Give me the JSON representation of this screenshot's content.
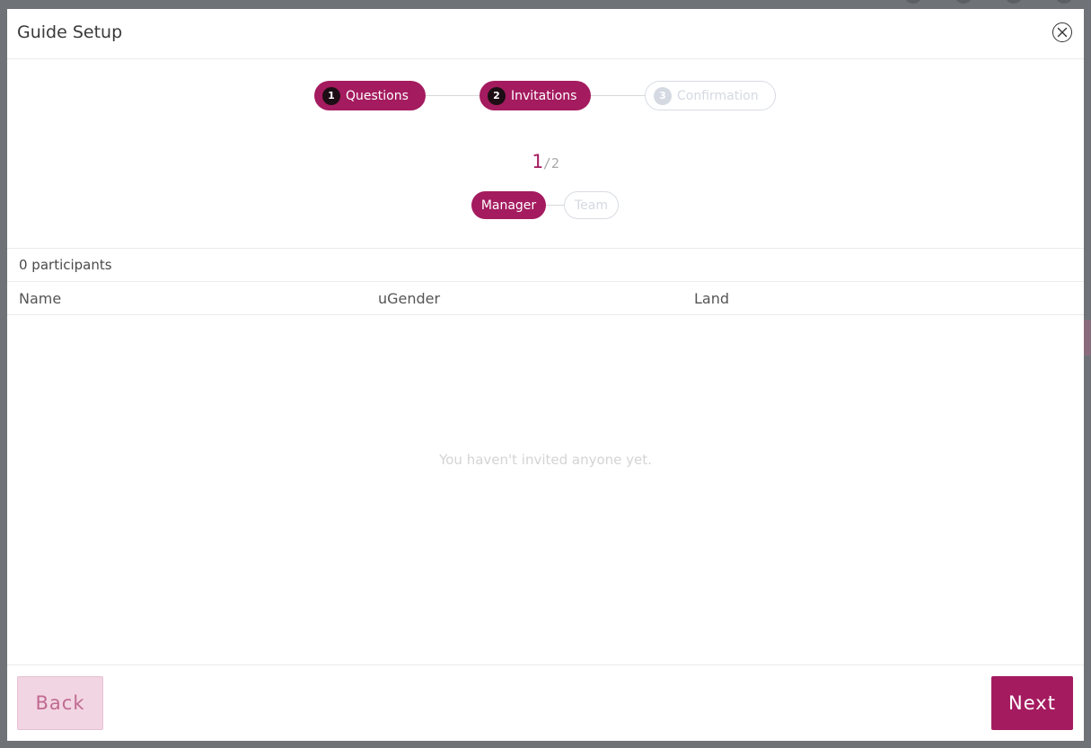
{
  "modal": {
    "title": "Guide Setup"
  },
  "stepper": {
    "steps": [
      {
        "number": "1",
        "label": "Questions",
        "state": "active"
      },
      {
        "number": "2",
        "label": "Invitations",
        "state": "active"
      },
      {
        "number": "3",
        "label": "Confirmation",
        "state": "inactive"
      }
    ]
  },
  "pager": {
    "current": "1",
    "separator": "/",
    "total": "2"
  },
  "substeps": [
    {
      "label": "Manager",
      "state": "active"
    },
    {
      "label": "Team",
      "state": "inactive"
    }
  ],
  "participants": {
    "count_label": "0 participants"
  },
  "table": {
    "columns": [
      "Name",
      "uGender",
      "Land"
    ]
  },
  "empty_state": {
    "message": "You haven't invited anyone yet."
  },
  "footer": {
    "back_label": "Back",
    "next_label": "Next"
  },
  "colors": {
    "accent": "#a41b5f",
    "accent_light": "#f2d5e2",
    "inactive": "#d4d9e2"
  },
  "icons": {
    "close": "close-icon"
  }
}
